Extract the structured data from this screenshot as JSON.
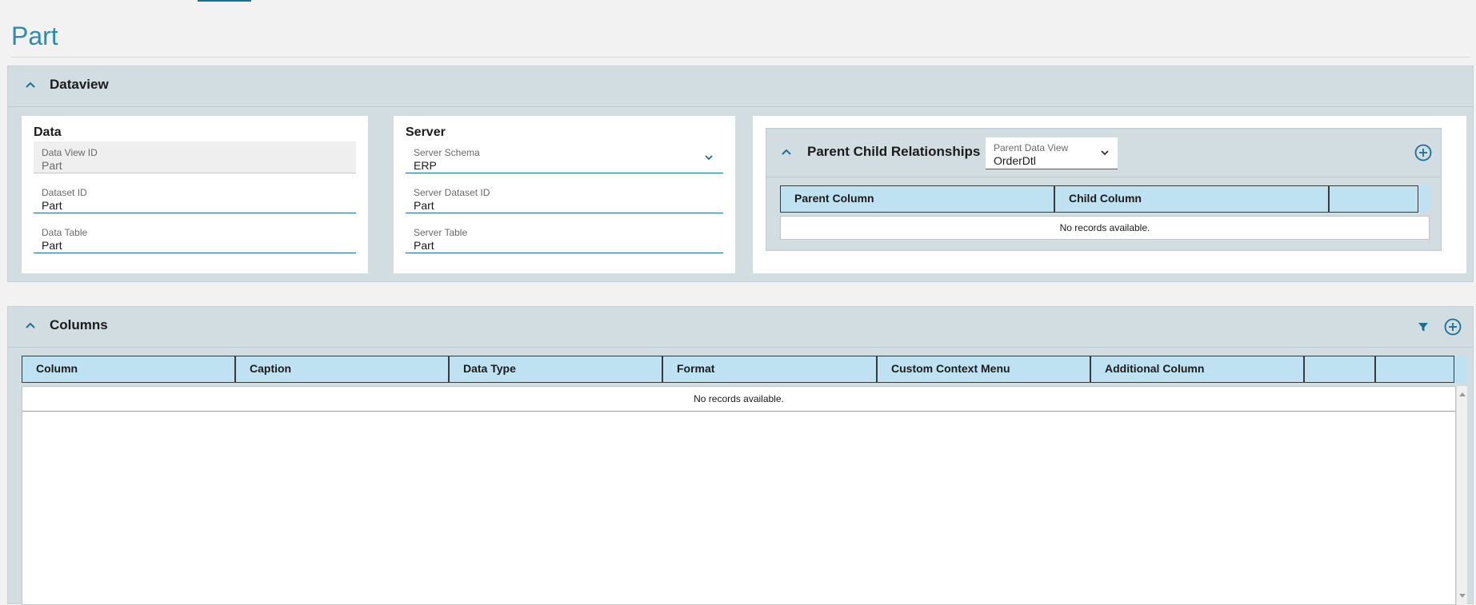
{
  "page": {
    "title": "Part"
  },
  "dataview_section": {
    "title": "Dataview",
    "data_card": {
      "title": "Data",
      "fields": [
        {
          "label": "Data View ID",
          "value": "Part"
        },
        {
          "label": "Dataset ID",
          "value": "Part"
        },
        {
          "label": "Data Table",
          "value": "Part"
        }
      ]
    },
    "server_card": {
      "title": "Server",
      "fields": [
        {
          "label": "Server Schema",
          "value": "ERP"
        },
        {
          "label": "Server Dataset ID",
          "value": "Part"
        },
        {
          "label": "Server Table",
          "value": "Part"
        }
      ]
    },
    "relationships": {
      "title": "Parent Child Relationships",
      "parent_data_view": {
        "label": "Parent Data View",
        "value": "OrderDtl"
      },
      "columns": [
        "Parent Column",
        "Child Column",
        ""
      ],
      "empty_text": "No records available."
    }
  },
  "columns_section": {
    "title": "Columns",
    "columns": [
      "Column",
      "Caption",
      "Data Type",
      "Format",
      "Custom Context Menu",
      "Additional Column",
      "",
      ""
    ],
    "empty_text": "No records available."
  },
  "icons": {
    "collapse": "chevron-up-icon",
    "dropdown": "chevron-down-icon",
    "add": "add-circle-icon",
    "filter": "filter-icon"
  },
  "colors": {
    "accent": "#1a6f96",
    "title": "#2a8cb3",
    "grid_header": "#bfe2f3",
    "section_bg": "#d2dde1"
  }
}
